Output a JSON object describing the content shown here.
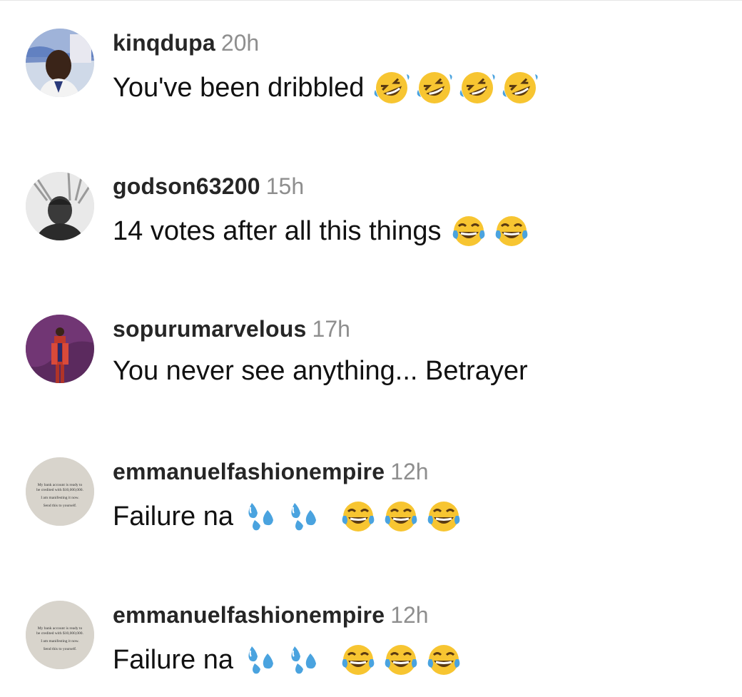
{
  "comments": [
    {
      "username": "kinqdupa",
      "time": "20h",
      "text": "You've been dribbled",
      "emojis": [
        "rofl-emoji",
        "rofl-emoji",
        "rofl-emoji",
        "rofl-emoji"
      ]
    },
    {
      "username": "godson63200",
      "time": "15h",
      "text": "14 votes after all this things",
      "emojis": [
        "tears-of-joy-emoji",
        "tears-of-joy-emoji"
      ]
    },
    {
      "username": "sopurumarvelous",
      "time": "17h",
      "text": "You never see anything... Betrayer",
      "emojis": []
    },
    {
      "username": "emmanuelfashionempire",
      "time": "12h",
      "text": "Failure na",
      "emojis": [
        "sweat-droplets-emoji",
        "sweat-droplets-emoji",
        "tears-of-joy-emoji",
        "tears-of-joy-emoji",
        "tears-of-joy-emoji"
      ],
      "avatar_text": [
        "My bank account is ready to",
        "be credited with $10,000,000.",
        "I am manifesting it now.",
        "Send this to yourself."
      ]
    },
    {
      "username": "emmanuelfashionempire",
      "time": "12h",
      "text": "Failure na",
      "emojis": [
        "sweat-droplets-emoji",
        "sweat-droplets-emoji",
        "tears-of-joy-emoji",
        "tears-of-joy-emoji",
        "tears-of-joy-emoji"
      ],
      "avatar_text": [
        "My bank account is ready to",
        "be credited with $10,000,000.",
        "I am manifesting it now.",
        "Send this to yourself."
      ]
    }
  ],
  "colors": {
    "username": "#262626",
    "timestamp": "#8e8e8e",
    "emoji_yellow": "#f7c531",
    "tear_blue": "#4aa3df"
  }
}
